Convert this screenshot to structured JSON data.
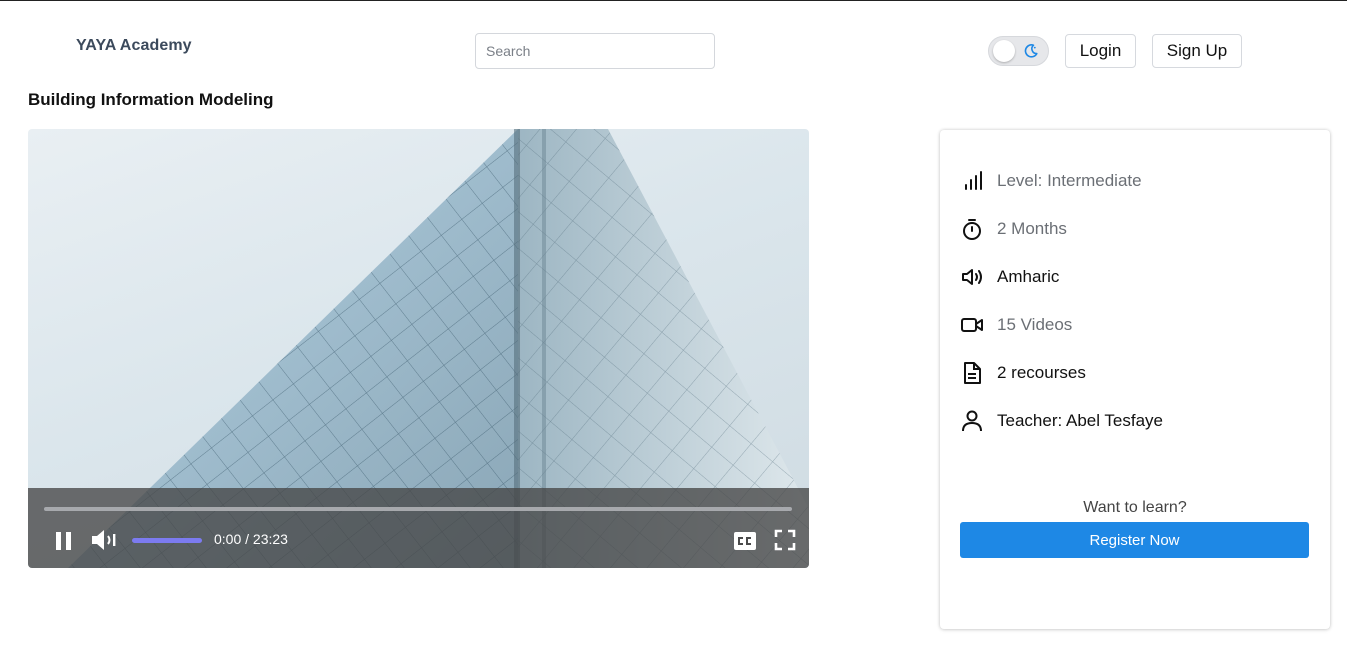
{
  "header": {
    "brand": "YAYA Academy",
    "search_placeholder": "Search",
    "login_label": "Login",
    "signup_label": "Sign Up",
    "theme_toggle_icon": "moon-icon"
  },
  "course": {
    "title": "Building Information Modeling"
  },
  "player": {
    "current_time": "0:00",
    "duration": "23:23",
    "timecode": "0:00 / 23:23",
    "progress_fraction": 0.0,
    "volume_fraction": 1.0,
    "icons": [
      "pause-icon",
      "volume-icon",
      "closed-captions-icon",
      "fullscreen-icon"
    ],
    "volume_color": "#7c7bf0"
  },
  "info": {
    "items": [
      {
        "icon": "bar-chart-icon",
        "text": "Level: Intermediate"
      },
      {
        "icon": "stopwatch-icon",
        "text": "2 Months"
      },
      {
        "icon": "speaker-icon",
        "text": "Amharic"
      },
      {
        "icon": "video-camera-icon",
        "text": "15 Videos"
      },
      {
        "icon": "document-icon",
        "text": "2 recourses"
      },
      {
        "icon": "user-icon",
        "text": "Teacher: Abel Tesfaye"
      }
    ],
    "cta_prompt": "Want to learn?",
    "register_label": "Register Now",
    "accent_color": "#1e88e5"
  }
}
